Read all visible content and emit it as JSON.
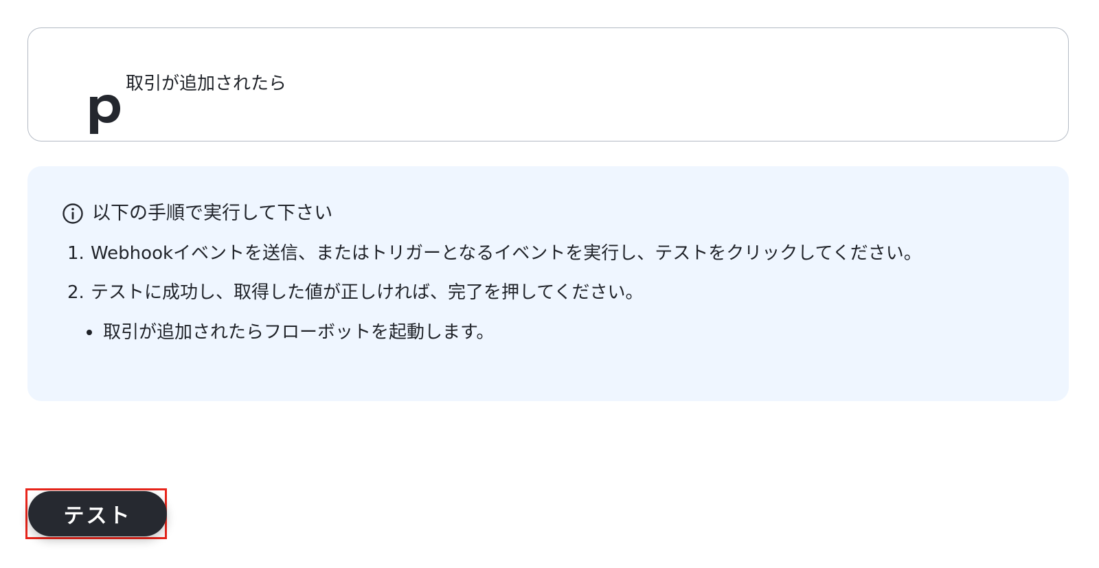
{
  "trigger": {
    "app_icon": "pipedrive-p-icon",
    "title": "取引が追加されたら"
  },
  "instructions": {
    "heading_icon": "info-circle-icon",
    "heading": "以下の手順で実行して下さい",
    "steps": [
      {
        "number": "1.",
        "text": "Webhookイベントを送信、またはトリガーとなるイベントを実行し、テストをクリックしてください。"
      },
      {
        "number": "2.",
        "text": "テストに成功し、取得した値が正しければ、完了を押してください。"
      }
    ],
    "bullets": [
      {
        "text": "取引が追加されたらフローボットを起動します。"
      }
    ],
    "background_color": "#eff6ff"
  },
  "actions": {
    "test_label": "テスト",
    "test_button_color": "#262930",
    "highlight_color": "#e8251b"
  }
}
